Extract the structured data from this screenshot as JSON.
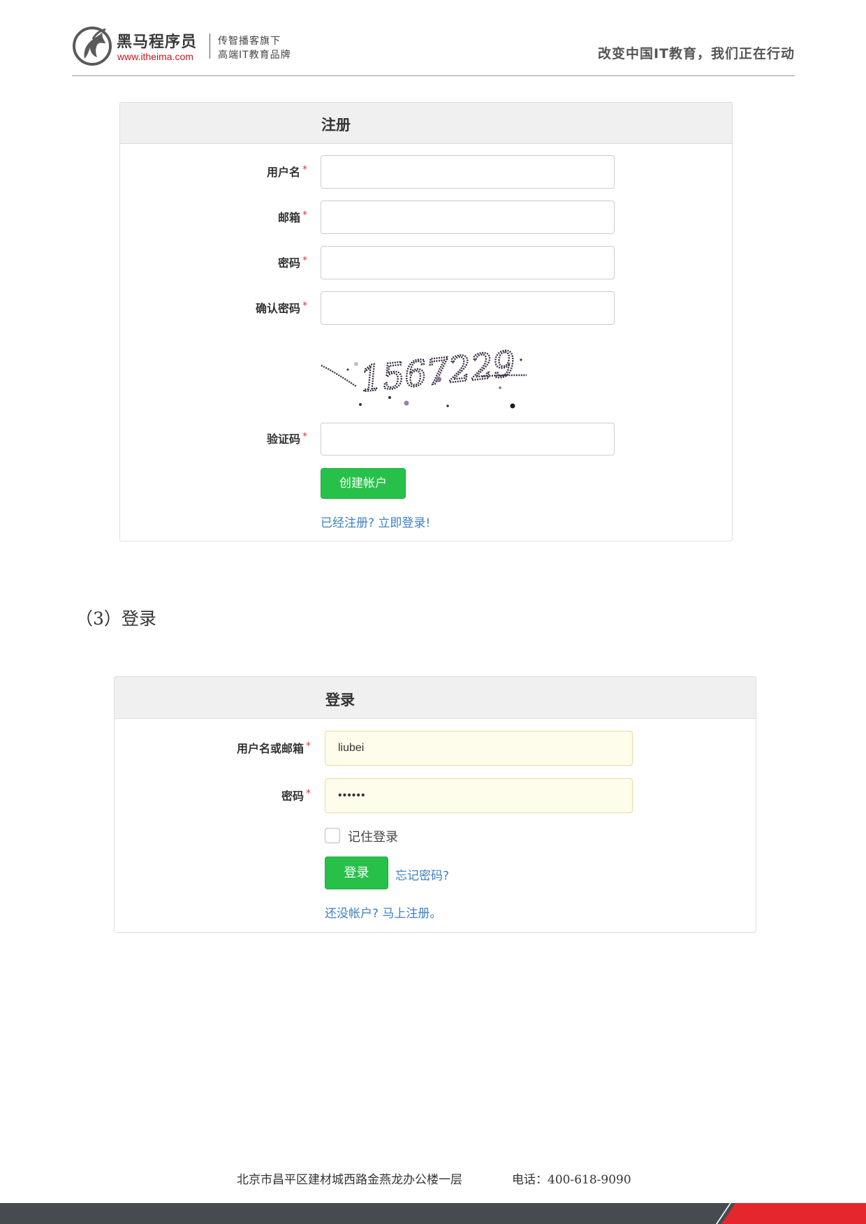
{
  "header": {
    "brand_name": "黑马程序员",
    "brand_url": "www.itheima.com",
    "tagline_line1": "传智播客旗下",
    "tagline_line2": "高端IT教育品牌",
    "slogan": "改变中国IT教育，我们正在行动"
  },
  "register": {
    "title": "注册",
    "required_mark": "*",
    "username_label": "用户名",
    "email_label": "邮箱",
    "password_label": "密码",
    "confirm_password_label": "确认密码",
    "captcha_label": "验证码",
    "captcha_text": "1567229",
    "submit_label": "创建帐户",
    "login_link": "已经注册? 立即登录!"
  },
  "section": {
    "heading": "（3）登录"
  },
  "login": {
    "title": "登录",
    "required_mark": "*",
    "username_label": "用户名或邮箱",
    "username_value": "liubei",
    "password_label": "密码",
    "password_value": "••••••",
    "remember_label": "记住登录",
    "remember_checked": false,
    "submit_label": "登录",
    "forgot_link": "忘记密码?",
    "register_link": "还没帐户? 马上注册。"
  },
  "footer": {
    "address": "北京市昌平区建材城西路金燕龙办公楼一层",
    "phone": "电话：400-618-9090"
  },
  "colors": {
    "accent_green": "#27c14a",
    "link_blue": "#3d7fc3",
    "required_red": "#e0353b",
    "brand_red": "#c8161d",
    "footer_dark": "#454b4f"
  }
}
